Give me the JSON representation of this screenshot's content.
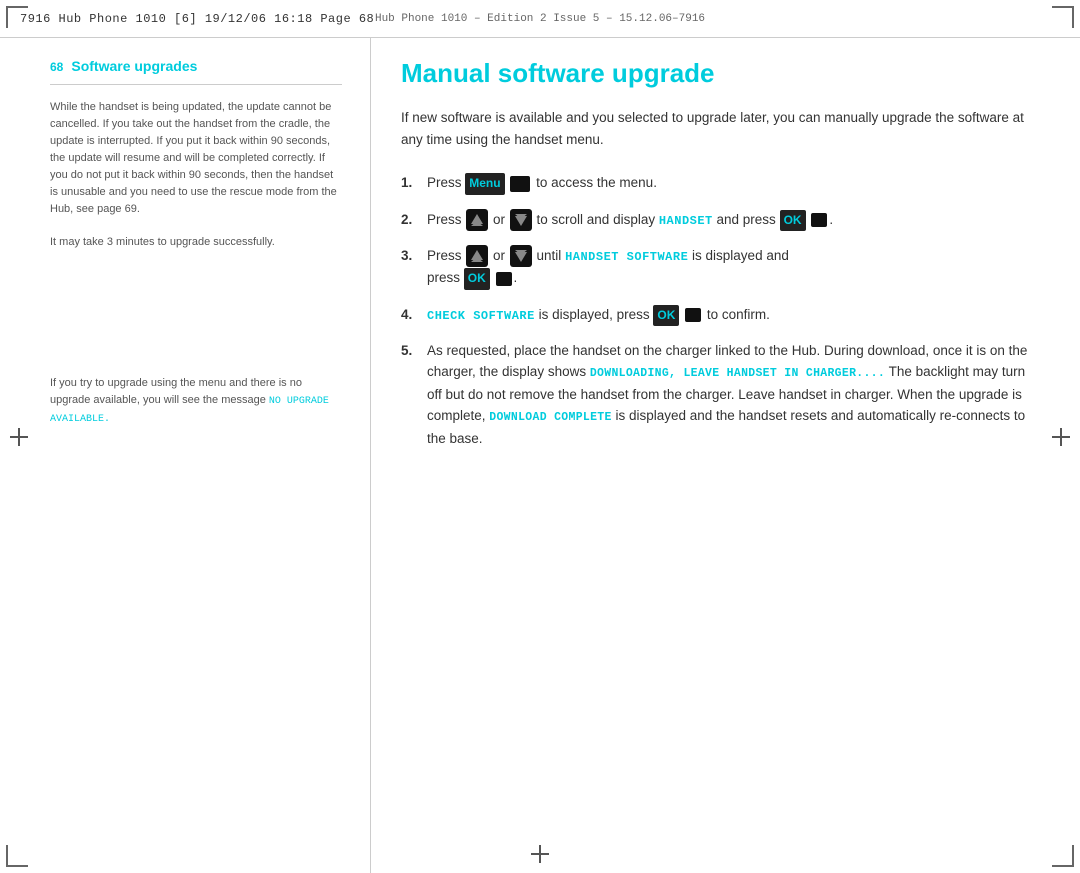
{
  "header": {
    "left_text": "7916  Hub  Phone  1010  [6]   19/12/06   16:18   Page  68",
    "center_text": "Hub Phone 1010 – Edition 2 Issue 5 – 15.12.06–7916"
  },
  "sidebar": {
    "page_number": "68",
    "section_title": "Software upgrades",
    "note1": "While the handset is being updated, the update cannot be cancelled. If you take out the handset from the cradle, the update is interrupted. If you put it back within 90 seconds, the update will resume and will be completed correctly. If you do not put it back within 90 seconds, then the handset is unusable and you need to use the rescue mode from the Hub, see page 69.",
    "note2": "It may take 3 minutes to upgrade successfully.",
    "note3": "If you try to upgrade using the menu and there is no upgrade available, you will see the message ",
    "no_upgrade_label": "NO UPGRADE AVAILABLE."
  },
  "main": {
    "title": "Manual software upgrade",
    "intro": "If new software is available and you selected to upgrade later, you can manually upgrade the software at any time using the handset menu.",
    "steps": [
      {
        "number": "1.",
        "text_before": "Press ",
        "menu_label": "Menu",
        "text_after": " to access the menu."
      },
      {
        "number": "2.",
        "text_before": "Press",
        "text_middle": "or",
        "text_display": "HANDSET",
        "text_press_ok": "press ",
        "ok_label": "OK"
      },
      {
        "number": "3.",
        "text_before": "Press",
        "text_middle": "or",
        "text_until": "until",
        "text_display": "HANDSET SOFTWARE",
        "text_displayed": "is displayed and",
        "text_press_ok": "press ",
        "ok_label": "OK"
      },
      {
        "number": "4.",
        "text_display": "CHECK SOFTWARE",
        "text_after": "is displayed, press",
        "ok_label": "OK",
        "text_confirm": "to confirm."
      },
      {
        "number": "5.",
        "text_full": "As requested, place the handset on the charger linked to the Hub. During download, once it is on the charger, the display shows",
        "downloading_display": "DOWNLOADING, LEAVE HANDSET IN CHARGER....",
        "text_after_download": "The backlight may turn off but do not remove the handset from the charger. Leave handset in charger. When the upgrade is complete,",
        "complete_display": "DOWNLOAD COMPLETE",
        "text_final": "is displayed and the handset resets and automatically re-connects to the base."
      }
    ]
  }
}
